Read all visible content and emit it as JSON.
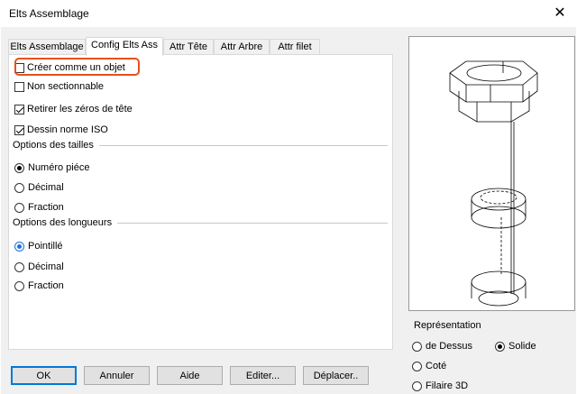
{
  "window": {
    "title": "Elts Assemblage",
    "close_glyph": "✕"
  },
  "tabs": [
    {
      "label": "Elts Assemblage"
    },
    {
      "label": "Config Elts Ass"
    },
    {
      "label": "Attr Tête"
    },
    {
      "label": "Attr  Arbre"
    },
    {
      "label": "Attr filet"
    }
  ],
  "options": {
    "create_object": {
      "label": "Créer comme un objet",
      "checked": false
    },
    "non_sectionable": {
      "label": "Non sectionnable",
      "checked": false
    },
    "remove_head_zeros": {
      "label": "Retirer les zéros de tête",
      "checked": true
    },
    "iso_drawing": {
      "label": "Dessin norme ISO",
      "checked": true
    }
  },
  "size_options": {
    "title": "Options des tailles",
    "items": [
      {
        "label": "Numéro piéce",
        "selected": true
      },
      {
        "label": "Décimal",
        "selected": false
      },
      {
        "label": "Fraction",
        "selected": false
      }
    ]
  },
  "length_options": {
    "title": "Options des longueurs",
    "items": [
      {
        "label": "Pointillé",
        "selected": true
      },
      {
        "label": "Décimal",
        "selected": false
      },
      {
        "label": "Fraction",
        "selected": false
      }
    ]
  },
  "representation": {
    "title": "Représentation",
    "items": [
      {
        "label": "de Dessus",
        "selected": false
      },
      {
        "label": "Solide",
        "selected": true
      },
      {
        "label": "Coté",
        "selected": false
      },
      {
        "label": "Filaire 3D",
        "selected": false
      }
    ]
  },
  "buttons": {
    "ok": "OK",
    "cancel": "Annuler",
    "help": "Aide",
    "edit": "Editer...",
    "move": "Déplacer.."
  },
  "colors": {
    "highlight": "#e8501c",
    "accent": "#1a73d9"
  }
}
